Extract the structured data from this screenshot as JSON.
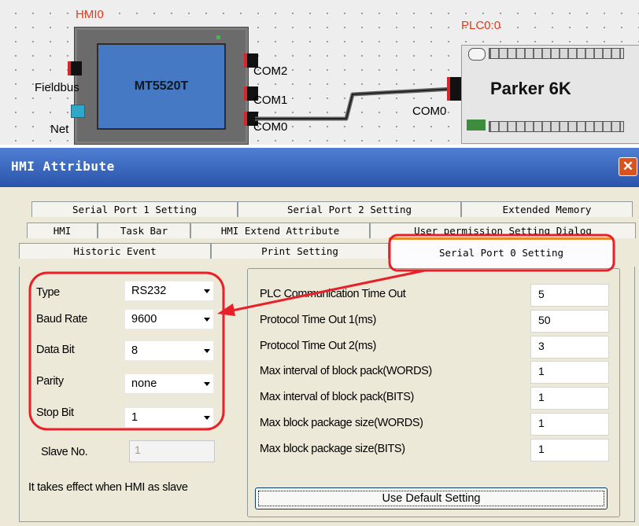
{
  "diagram": {
    "hmi_label": "HMI0",
    "hmi_model": "MT5520T",
    "fieldbus_label": "Fieldbus",
    "net_label": "Net",
    "ports": [
      "COM2",
      "COM1",
      "COM0"
    ],
    "plc_label": "PLC0:0",
    "plc_port": "COM0",
    "plc_name": "Parker 6K",
    "colors": {
      "label_red": "#e33b1a",
      "hmi_screen": "#4679c4",
      "annotation": "#e8202a"
    }
  },
  "dialog": {
    "title": "HMI Attribute",
    "close_icon": "close-icon",
    "tabs_row1": [
      "Serial Port 1 Setting",
      "Serial Port 2 Setting",
      "Extended Memory"
    ],
    "tabs_row2": [
      "HMI",
      "Task Bar",
      "HMI Extend Attribute",
      "User permission Setting Dialog"
    ],
    "tabs_row3": [
      "Historic Event",
      "Print Setting",
      "Serial Port 0 Setting"
    ],
    "active_tab": "Serial Port 0 Setting",
    "port": {
      "type_label": "Type",
      "type_value": "RS232",
      "baud_label": "Baud Rate",
      "baud_value": "9600",
      "databit_label": "Data Bit",
      "databit_value": "8",
      "parity_label": "Parity",
      "parity_value": "none",
      "stopbit_label": "Stop Bit",
      "stopbit_value": "1",
      "slave_label": "Slave No.",
      "slave_value": "1",
      "note": "It takes effect when HMI as slave"
    },
    "params": [
      {
        "label": "PLC Communication Time Out",
        "value": "5"
      },
      {
        "label": "Protocol Time Out 1(ms)",
        "value": "50"
      },
      {
        "label": "Protocol Time Out 2(ms)",
        "value": "3"
      },
      {
        "label": "Max interval of block pack(WORDS)",
        "value": "1"
      },
      {
        "label": "Max interval of block pack(BITS)",
        "value": "1"
      },
      {
        "label": "Max block package size(WORDS)",
        "value": "1"
      },
      {
        "label": "Max block package size(BITS)",
        "value": "1"
      }
    ],
    "default_button": "Use Default Setting"
  }
}
